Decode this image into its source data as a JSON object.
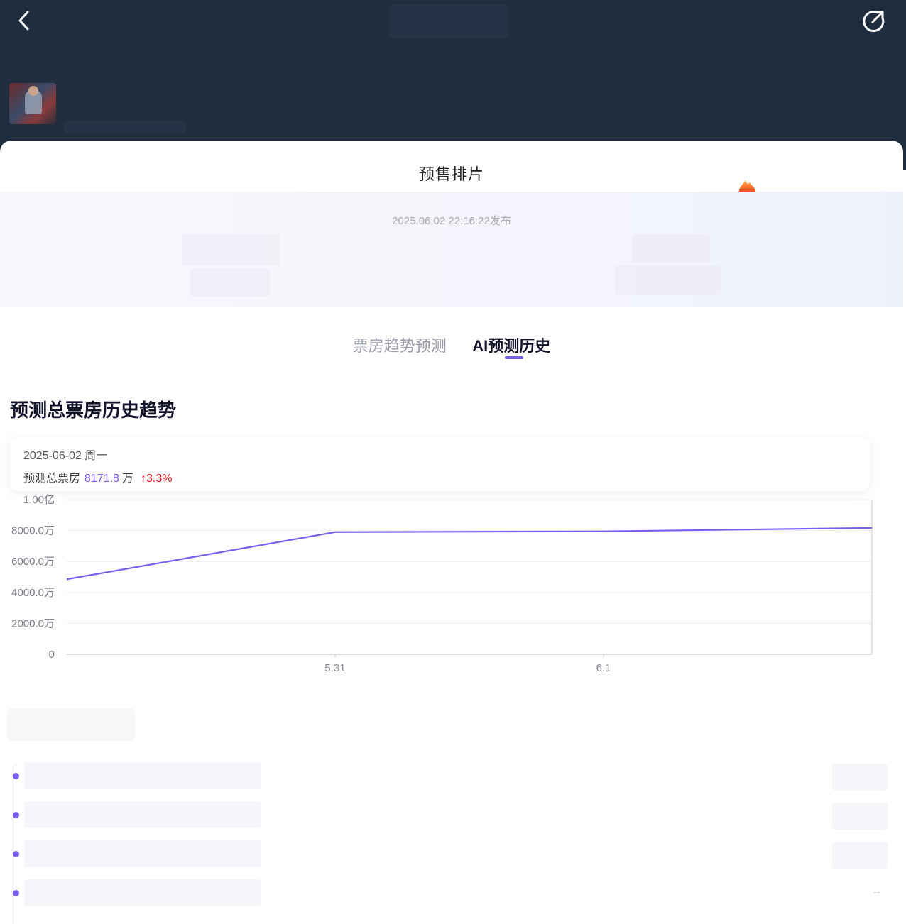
{
  "header": {
    "back_icon": "back-arrow-icon",
    "share_icon": "share-icon"
  },
  "panel": {
    "title": "预售排片",
    "publish_time": "2025.06.02 22:16:22发布"
  },
  "tabs": [
    {
      "label": "票房趋势预测",
      "active": false
    },
    {
      "label": "AI预测历史",
      "active": true
    }
  ],
  "section": {
    "title": "预测总票房历史趋势"
  },
  "tooltip": {
    "date": "2025-06-02  周一",
    "metric_label": "预测总票房",
    "value": "8171.8",
    "unit": "万",
    "change": "↑3.3%"
  },
  "chart_data": {
    "type": "line",
    "ytick_labels": [
      "0",
      "2000.0万",
      "4000.0万",
      "6000.0万",
      "8000.0万",
      "1.00亿"
    ],
    "ylim_wan": [
      0,
      10000
    ],
    "xtick_labels": [
      "5.31",
      "6.1"
    ],
    "series": [
      {
        "x": [
          "5.30",
          "5.31",
          "6.1",
          "6.2"
        ],
        "values": [
          4850,
          7900,
          7950,
          8171.8
        ]
      }
    ],
    "color": "#7d5cf0"
  },
  "history_list": {
    "items": [
      {
        "value": ""
      },
      {
        "value": ""
      },
      {
        "value": ""
      },
      {
        "value": "--"
      }
    ]
  }
}
